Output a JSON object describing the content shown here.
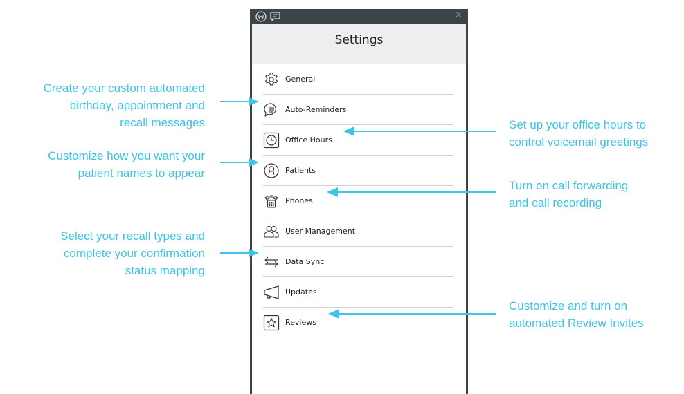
{
  "window": {
    "title": "Settings",
    "controls": "_ ×",
    "icons": [
      "app-logo-icon",
      "chat-icon"
    ]
  },
  "menu": {
    "items": [
      {
        "label": "General",
        "icon": "gear-icon"
      },
      {
        "label": "Auto-Reminders",
        "icon": "message-icon"
      },
      {
        "label": "Office Hours",
        "icon": "clock-icon"
      },
      {
        "label": "Patients",
        "icon": "patient-icon"
      },
      {
        "label": "Phones",
        "icon": "phone-icon"
      },
      {
        "label": "User Management",
        "icon": "users-icon"
      },
      {
        "label": "Data Sync",
        "icon": "sync-arrows-icon"
      },
      {
        "label": "Updates",
        "icon": "megaphone-icon"
      },
      {
        "label": "Reviews",
        "icon": "star-icon"
      }
    ]
  },
  "annotations": {
    "auto_reminders": [
      "Create your custom automated",
      "birthday, appointment and",
      "recall messages"
    ],
    "patients": [
      "Customize how you want your",
      "patient names to appear"
    ],
    "data_sync": [
      "Select your recall types and",
      "complete your confirmation",
      "status mapping"
    ],
    "office_hours": [
      "Set up your office hours to",
      "control voicemail greetings"
    ],
    "phones": [
      "Turn on call forwarding",
      "and call recording"
    ],
    "reviews": [
      "Customize and turn on",
      "automated Review Invites"
    ]
  },
  "colors": {
    "accent": "#3fc3e6",
    "window_frame": "#3d4448",
    "header_bg": "#eceeef"
  }
}
